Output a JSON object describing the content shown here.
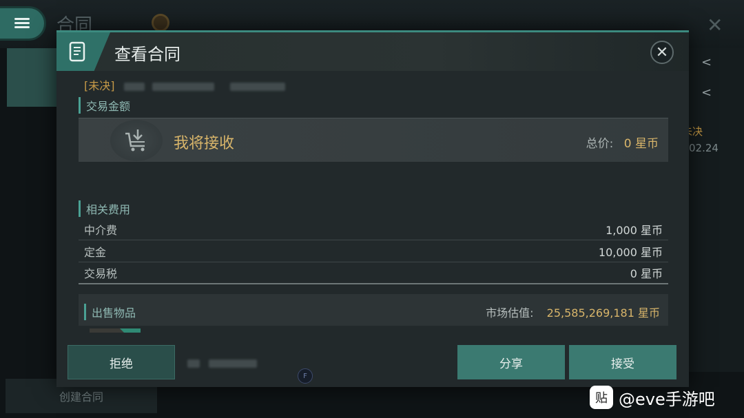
{
  "background": {
    "title": "合同",
    "create_contract": "创建合同",
    "right_panel": {
      "status_text": "未决",
      "time_text": "02.24"
    }
  },
  "modal": {
    "title": "查看合同",
    "status": "[未决]",
    "trade_amount_label": "交易金额",
    "receive": {
      "label": "我将接收",
      "total_label": "总价:",
      "total_value": "0 星币"
    },
    "fees_label": "相关费用",
    "fees": [
      {
        "name": "中介费",
        "value": "1,000 星币"
      },
      {
        "name": "定金",
        "value": "10,000 星币"
      },
      {
        "name": "交易税",
        "value": "0 星币"
      }
    ],
    "items": {
      "label": "出售物品",
      "market_label": "市场估值:",
      "market_value": "25,585,269,181 星币"
    },
    "buttons": {
      "reject": "拒绝",
      "share": "分享",
      "accept": "接受"
    },
    "scroll_indicator": "F"
  },
  "watermark": {
    "logo": "贴",
    "text": "@eve手游吧"
  },
  "colors": {
    "accent": "#3b7a71",
    "gold": "#d8b56a",
    "status": "#c69a48"
  },
  "icons": {
    "menu": "menu-icon",
    "close": "close-icon",
    "contract": "contract-icon",
    "receive": "download-cart-icon",
    "item_badge": "diamond-icon"
  }
}
